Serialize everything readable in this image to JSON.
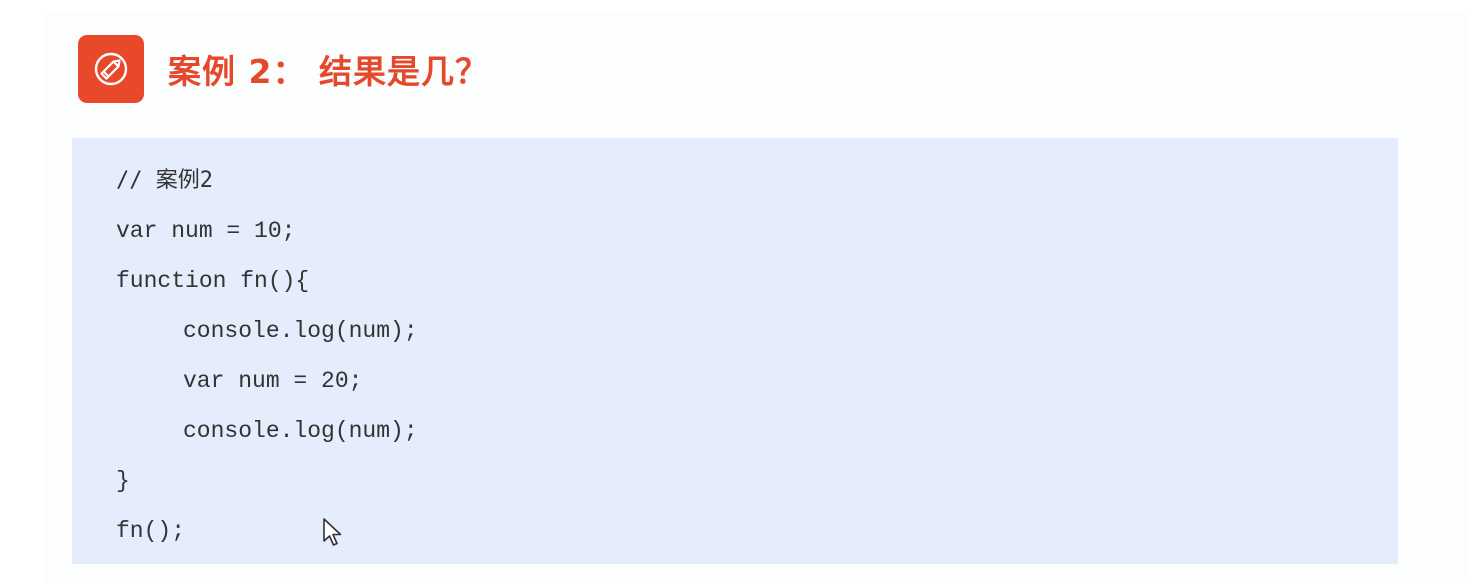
{
  "slide": {
    "title": "案例 2： 结果是几？",
    "icon": "pencil-icon",
    "accent_color": "#e8492b"
  },
  "code": {
    "background_color": "#e5edfc",
    "lines": [
      "// 案例2",
      "var num = 10;",
      "function fn(){",
      "console.log(num);",
      "var num = 20;",
      "console.log(num);",
      "}",
      "fn();"
    ]
  },
  "cursor": "mouse-pointer-icon"
}
